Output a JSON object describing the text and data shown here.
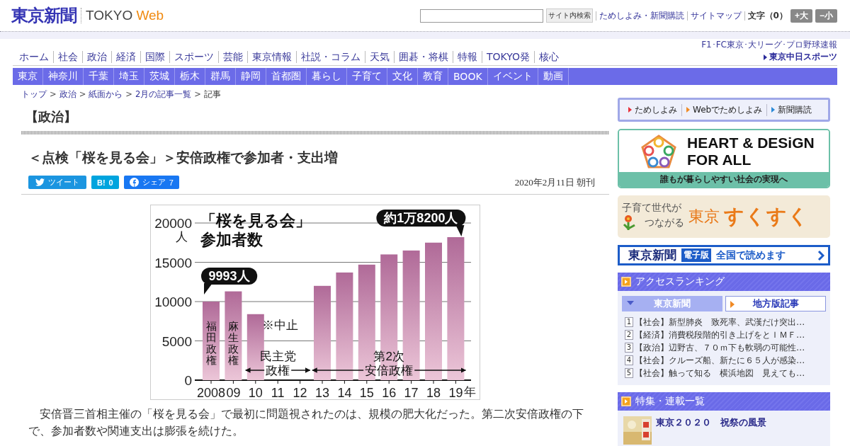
{
  "header": {
    "logo": "東京新聞",
    "site_name": "TOKYO",
    "site_suffix": "Web",
    "search_button": "サイト内検索",
    "links": [
      "ためしよみ・新聞購読",
      "サイトマップ"
    ],
    "font_size_label": "文字（0）",
    "font_buttons": [
      "+大",
      "−小"
    ]
  },
  "nav_main": [
    "ホーム",
    "社会",
    "政治",
    "経済",
    "国際",
    "スポーツ",
    "芸能",
    "東京情報",
    "社説・コラム",
    "天気",
    "囲碁・将棋",
    "特報",
    "TOKYO発",
    "核心"
  ],
  "sports_link": {
    "caption": "F1･FC東京･大リーグ･プロ野球速報",
    "logo": "東京中日スポーツ"
  },
  "nav_regional": [
    "東京",
    "神奈川",
    "千葉",
    "埼玉",
    "茨城",
    "栃木",
    "群馬",
    "静岡",
    "首都圏",
    "暮らし",
    "子育て",
    "文化",
    "教育",
    "BOOK",
    "イベント",
    "動画"
  ],
  "breadcrumb": {
    "separator": ">",
    "items": [
      {
        "label": "トップ",
        "link": true
      },
      {
        "label": "政治",
        "link": true
      },
      {
        "label": "紙面から",
        "link": true
      },
      {
        "label": "2月の記事一覧",
        "link": true
      },
      {
        "label": "記事",
        "link": false
      }
    ]
  },
  "section_title": "【政治】",
  "article": {
    "headline": "＜点検「桜を見る会」＞安倍政権で参加者・支出増",
    "share_buttons": [
      {
        "kind": "twitter",
        "label": "ツイート"
      },
      {
        "kind": "hatena",
        "label": "B!",
        "count": "0"
      },
      {
        "kind": "facebook",
        "label": "シェア",
        "count": "7"
      }
    ],
    "date": "2020年2月11日 朝刊",
    "chart_data": {
      "type": "bar",
      "title": "「桜を見る会」参加者数",
      "xlabel": "年",
      "ylabel": "人",
      "categories": [
        "2008",
        "09",
        "10",
        "11",
        "12",
        "13",
        "14",
        "15",
        "16",
        "17",
        "18",
        "19"
      ],
      "values": [
        10000,
        11300,
        8400,
        null,
        null,
        12000,
        13700,
        14700,
        16000,
        16500,
        17500,
        18200
      ],
      "grid": true,
      "ylim": [
        0,
        20000
      ],
      "yticks": [
        0,
        5000,
        10000,
        15000,
        20000
      ],
      "annotations": [
        "9993人",
        "約1万8200人",
        "※中止",
        "福田政権",
        "麻生政権",
        "民主党政権",
        "第2次安倍政権"
      ]
    },
    "body": "　安倍晋三首相主催の「桜を見る会」で最初に問題視されたのは、規模の肥大化だった。第二次安倍政権の下で、参加者数や関連支出は膨張を続けた。"
  },
  "sidebar": {
    "trial_links": [
      {
        "label": "ためしよみ",
        "color": "#e8303a"
      },
      {
        "label": "Webでためしよみ",
        "color": "#f08a24"
      },
      {
        "label": "新聞購読",
        "color": "#2a8ad8"
      }
    ],
    "heart_banner": {
      "title_1": "HEART & DESiGN",
      "title_2": "FOR ALL",
      "tagline": "誰もが暮らしやすい社会の実現へ"
    },
    "sukusuku_banner": {
      "line_1": "子育て世代が",
      "line_2": "つながる",
      "word_1": "東京",
      "word_2": "すくすく"
    },
    "digital_banner": {
      "logo": "東京新聞",
      "badge": "電子版",
      "text": "全国で読めます"
    },
    "ranking": {
      "title": "アクセスランキング",
      "tabs": [
        {
          "label": "東京新聞",
          "selected": true
        },
        {
          "label": "地方版記事",
          "selected": false
        }
      ],
      "items": [
        {
          "rank": "1",
          "text": "【社会】新型肺炎　致死率、武漢だけ突出…"
        },
        {
          "rank": "2",
          "text": "【経済】消費税段階的引き上げをとＩＭＦ…"
        },
        {
          "rank": "3",
          "text": "【政治】辺野古、７０ｍ下も軟弱の可能性…"
        },
        {
          "rank": "4",
          "text": "【社会】クルーズ船、新たに６５人が感染…"
        },
        {
          "rank": "5",
          "text": "【社会】触って知る　横浜地図　見えても…"
        }
      ]
    },
    "features": {
      "title": "特集・連載一覧",
      "items": [
        {
          "kind": "picture",
          "title": "東京２０２０　祝祭の風景"
        }
      ]
    }
  }
}
